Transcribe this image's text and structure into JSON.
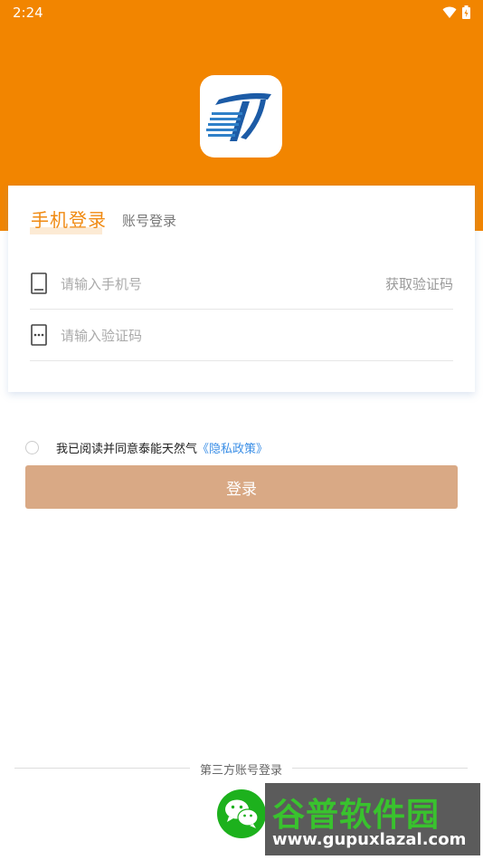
{
  "status_bar": {
    "time": "2:24"
  },
  "tabs": {
    "phone_login": "手机登录",
    "account_login": "账号登录"
  },
  "phone_field": {
    "placeholder": "请输入手机号",
    "value": ""
  },
  "code_field": {
    "placeholder": "请输入验证码",
    "value": ""
  },
  "get_code": "获取验证码",
  "agreement": {
    "text": "我已阅读并同意泰能天然气",
    "policy_link": "《隐私政策》"
  },
  "login_button": "登录",
  "third_party": {
    "label": "第三方账号登录",
    "wechat_icon": "wechat-icon"
  },
  "watermark": {
    "main": "谷普软件园",
    "url": "www.gupuxlazal.com"
  },
  "colors": {
    "header": "#F28500",
    "accent": "#F08A12",
    "button": "#D9A985",
    "link": "#3A8EE6",
    "wechat": "#1DB11D"
  }
}
